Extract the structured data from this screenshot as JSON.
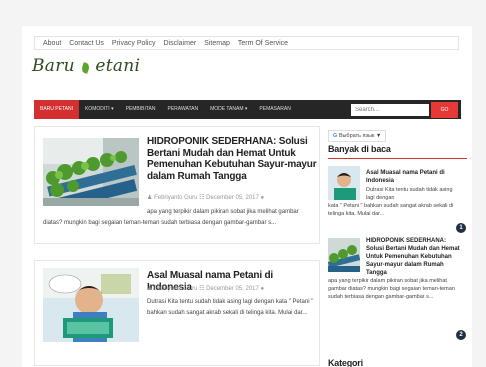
{
  "topnav": [
    "About",
    "Contact Us",
    "Privacy Policy",
    "Disclaimer",
    "Sitemap",
    "Term Of Service"
  ],
  "logo": {
    "part1": "Baru",
    "part2": "etani"
  },
  "mainnav": [
    "Baru Petani",
    "Komoditi ▾",
    "Pembibitan",
    "Perawatan",
    "Mode Tanam ▾",
    "Pemasaran"
  ],
  "search": {
    "placeholder": "Search...",
    "button": "GO"
  },
  "posts": [
    {
      "title": "HIDROPONIK SEDERHANA: Solusi Bertani Mudah dan Hemat Untuk Pemenuhan Kebutuhan Sayur-mayur dalam Rumah Tangga",
      "author": "Febriyanto Guru",
      "date": "December 05, 2017",
      "excerpt": "apa yang terpikir dalam pikiran sobat jika melihat gambar diatas? mungkin bagi segaian teman-teman sudah terbiasa dengan gambar-gambar s..."
    },
    {
      "title": "Asal Muasal nama Petani di Indonesia",
      "author": "Febriyanto Guru",
      "date": "December 05, 2017",
      "excerpt": "Dutrasi Kita tentu sudah tidak asing lagi dengan kata \" Petani \" bahkan sudah sangat akrab sekali di telinga kita. Mulai dar..."
    }
  ],
  "sidebar": {
    "translate": {
      "g": "G",
      "label": "Выбрать язык",
      "arrow": "▼"
    },
    "popular_heading": "Banyak di baca",
    "popular": [
      {
        "title": "Asal Muasal nama Petani di Indonesia",
        "text_small": "Dutrasi Kita tentu sudah tidak asing lagi dengan",
        "text_wide": "kata \" Petani \" bahkan sudah sangat akrab sekali di telinga kita. Mulai dar...",
        "num": "1"
      },
      {
        "title": "HIDROPONIK SEDERHANA: Solusi Bertani Mudah dan Hemat Untuk Pemenuhan Kebutuhan Sayur-mayur dalam Rumah Tangga",
        "text_wide": "apa yang terpikir dalam pikiran sobat jika melihat gambar diatas? mungkin bagi segaian teman-teman sudah terbiasa dengan gambar-gambar s...",
        "num": "2"
      }
    ],
    "category_heading": "Kategori"
  }
}
